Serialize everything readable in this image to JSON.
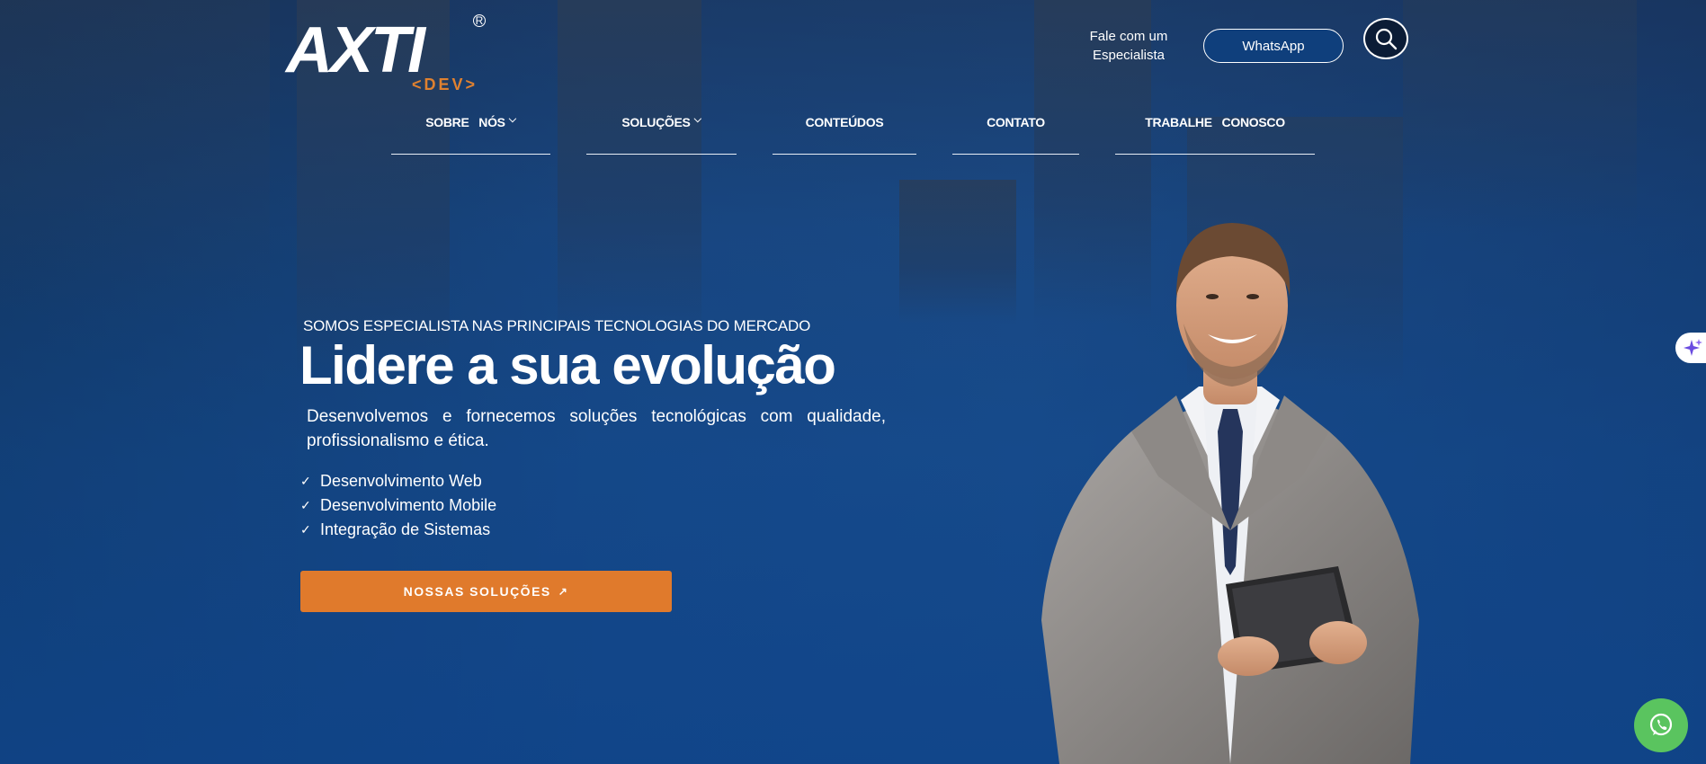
{
  "brand": {
    "logo_main": "AXTI",
    "logo_registered": "R",
    "logo_sub": "<DEV>",
    "accent_color": "#e07a2c"
  },
  "header": {
    "contact_text": "Fale com um Especialista",
    "whatsapp_label": "WhatsApp",
    "search_icon": "search-icon"
  },
  "nav": {
    "items": [
      {
        "label": "SOBRE   NÓS",
        "has_dropdown": true
      },
      {
        "label": "SOLUÇÕES",
        "has_dropdown": true
      },
      {
        "label": "CONTEÚDOS",
        "has_dropdown": false
      },
      {
        "label": "CONTATO",
        "has_dropdown": false
      },
      {
        "label": "TRABALHE   CONOSCO",
        "has_dropdown": false
      }
    ]
  },
  "hero": {
    "eyebrow": "SOMOS ESPECIALISTA NAS PRINCIPAIS TECNOLOGIAS DO MERCADO",
    "headline": "Lidere a sua evolução",
    "description": "Desenvolvemos e fornecemos soluções tecnológicas com qualidade, profissionalismo e ética.",
    "features": [
      "Desenvolvimento Web",
      "Desenvolvimento Mobile",
      "Integração de Sistemas"
    ],
    "cta_label": "NOSSAS SOLUÇÕES",
    "cta_icon": "arrow-up-right-icon"
  },
  "floating": {
    "ai_icon": "sparkle-icon",
    "whatsapp_icon": "whatsapp-icon",
    "whatsapp_color": "#5ac45f"
  }
}
